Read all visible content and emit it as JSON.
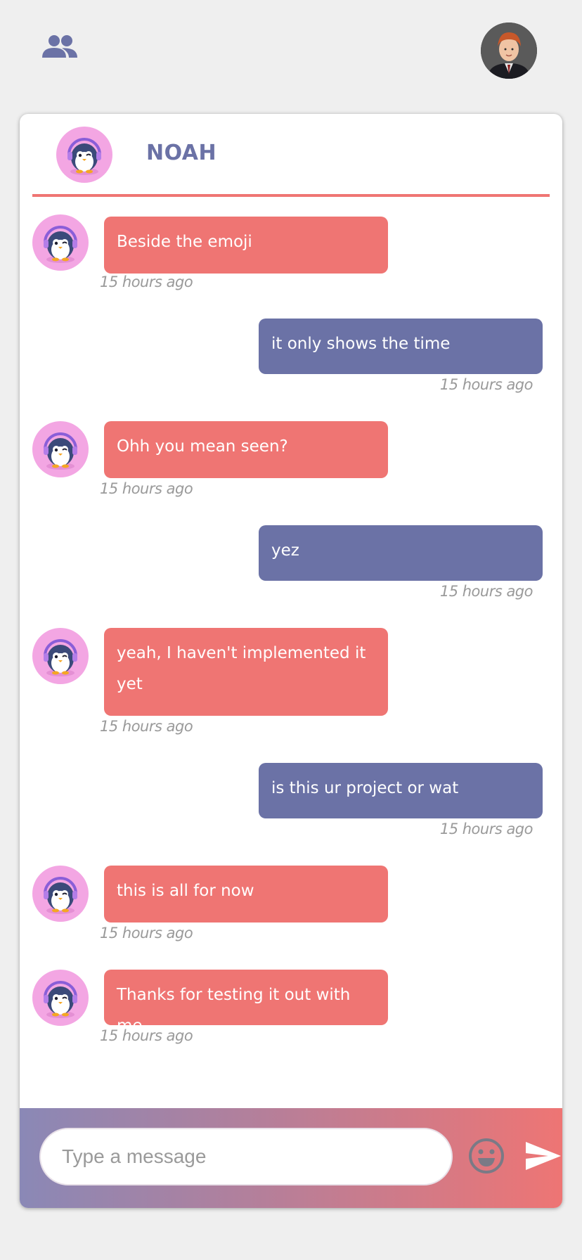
{
  "app": {
    "friends_icon": "people-icon",
    "profile_avatar": "user-avatar"
  },
  "chat": {
    "contact_name": "NOAH",
    "contact_avatar": "penguin-avatar"
  },
  "messages": [
    {
      "direction": "in",
      "text": "Beside the emoji",
      "time": "15 hours ago"
    },
    {
      "direction": "out",
      "text": "it only shows the time",
      "time": "15 hours ago"
    },
    {
      "direction": "in",
      "text": "Ohh you mean seen?",
      "time": "15 hours ago"
    },
    {
      "direction": "out",
      "text": "yez",
      "time": "15 hours ago"
    },
    {
      "direction": "in",
      "text": "yeah, I haven't implemented it yet",
      "time": "15 hours ago"
    },
    {
      "direction": "out",
      "text": "is this ur project or wat",
      "time": "15 hours ago"
    },
    {
      "direction": "in",
      "text": "this is all for now",
      "time": "15 hours ago"
    },
    {
      "direction": "in",
      "text": "Thanks for testing it out with me",
      "time": "15 hours ago"
    }
  ],
  "composer": {
    "placeholder": "Type a message",
    "value": "",
    "emoji_icon": "smiley-icon",
    "send_icon": "send-icon"
  },
  "colors": {
    "incoming": "#ef7573",
    "outgoing": "#6b72a6",
    "background": "#efefef"
  }
}
